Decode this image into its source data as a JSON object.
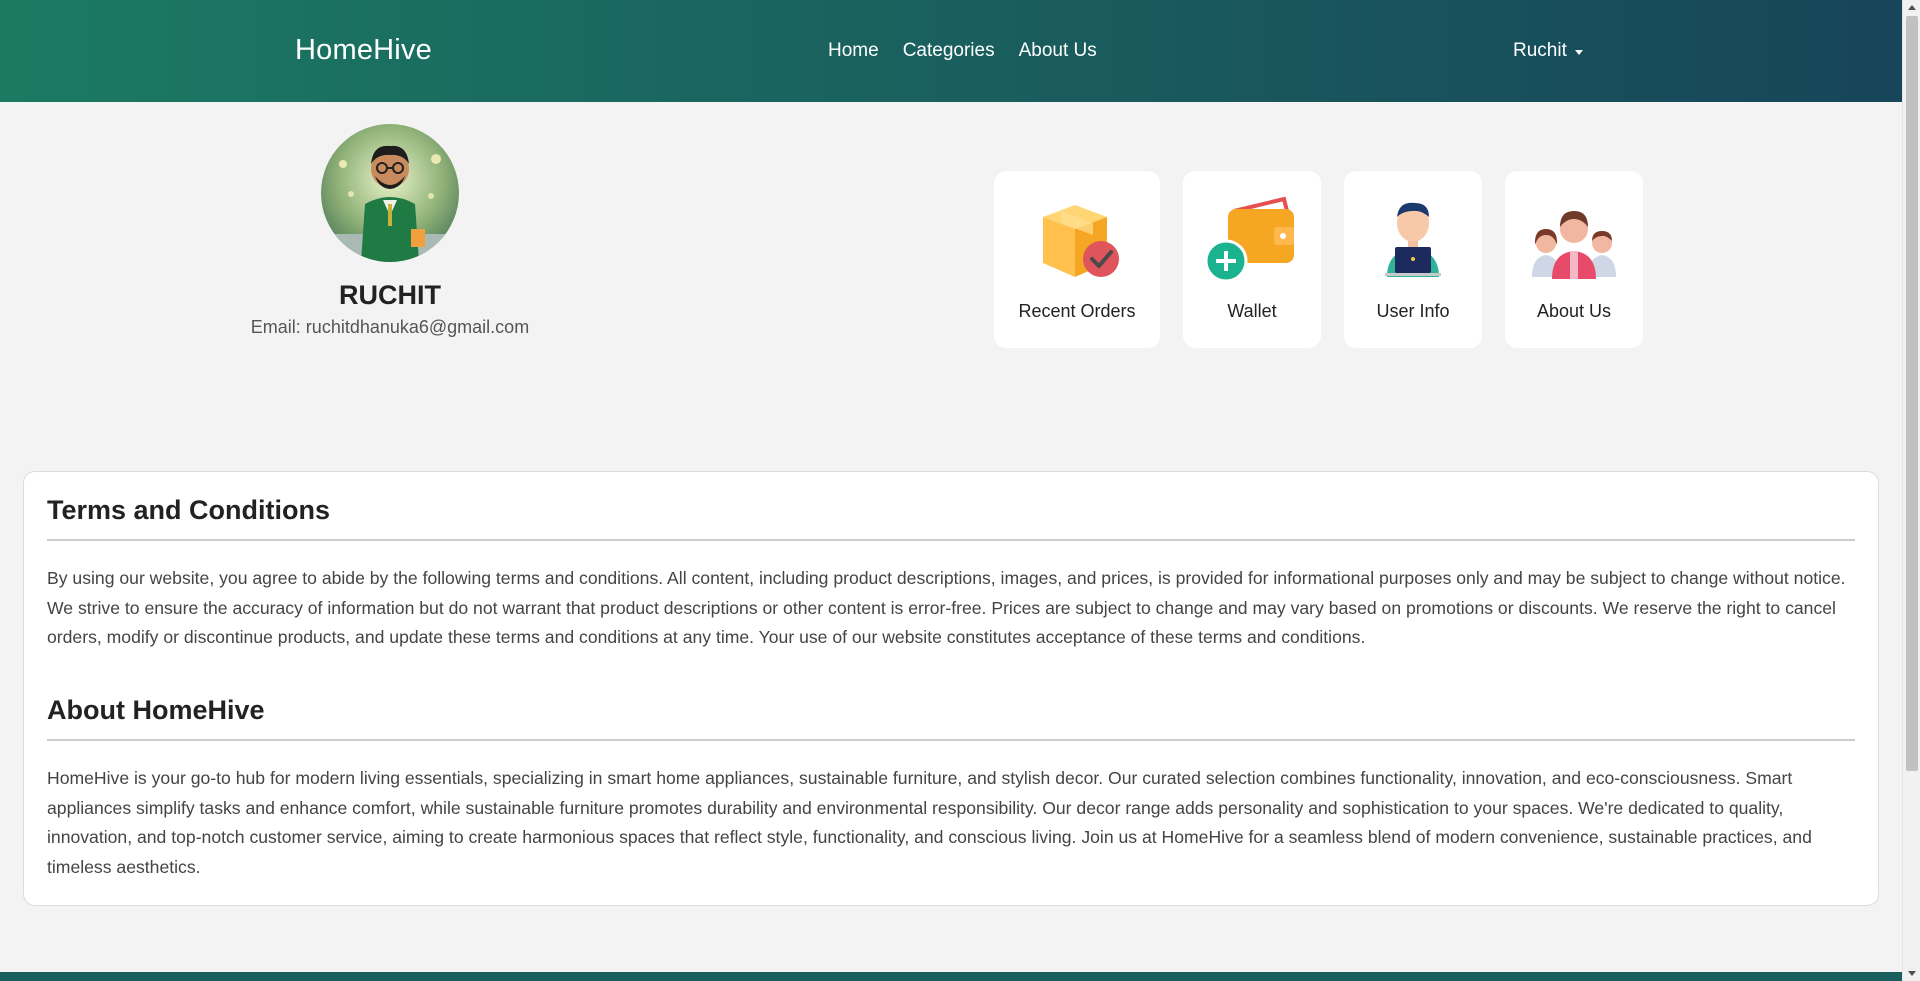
{
  "header": {
    "brand": "HomeHive",
    "nav": [
      "Home",
      "Categories",
      "About Us"
    ],
    "user": "Ruchit"
  },
  "profile": {
    "name": "RUCHIT",
    "email": "Email: ruchitdhanuka6@gmail.com"
  },
  "cards": [
    {
      "label": "Recent Orders",
      "icon": "package-check-icon"
    },
    {
      "label": "Wallet",
      "icon": "wallet-add-icon"
    },
    {
      "label": "User Info",
      "icon": "user-laptop-icon"
    },
    {
      "label": "About Us",
      "icon": "team-icon"
    }
  ],
  "terms": {
    "title": "Terms and Conditions",
    "text": "By using our website, you agree to abide by the following terms and conditions. All content, including product descriptions, images, and prices, is provided for informational purposes only and may be subject to change without notice. We strive to ensure the accuracy of information but do not warrant that product descriptions or other content is error-free. Prices are subject to change and may vary based on promotions or discounts. We reserve the right to cancel orders, modify or discontinue products, and update these terms and conditions at any time. Your use of our website constitutes acceptance of these terms and conditions."
  },
  "about": {
    "title": "About HomeHive",
    "text": "HomeHive is your go-to hub for modern living essentials, specializing in smart home appliances, sustainable furniture, and stylish decor. Our curated selection combines functionality, innovation, and eco-consciousness. Smart appliances simplify tasks and enhance comfort, while sustainable furniture promotes durability and environmental responsibility. Our decor range adds personality and sophistication to your spaces. We're dedicated to quality, innovation, and top-notch customer service, aiming to create harmonious spaces that reflect style, functionality, and conscious living. Join us at HomeHive for a seamless blend of modern convenience, sustainable practices, and timeless aesthetics."
  },
  "colors": {
    "header_start": "#1b7a62",
    "header_end": "#17455a",
    "background": "#f3f3f3"
  }
}
